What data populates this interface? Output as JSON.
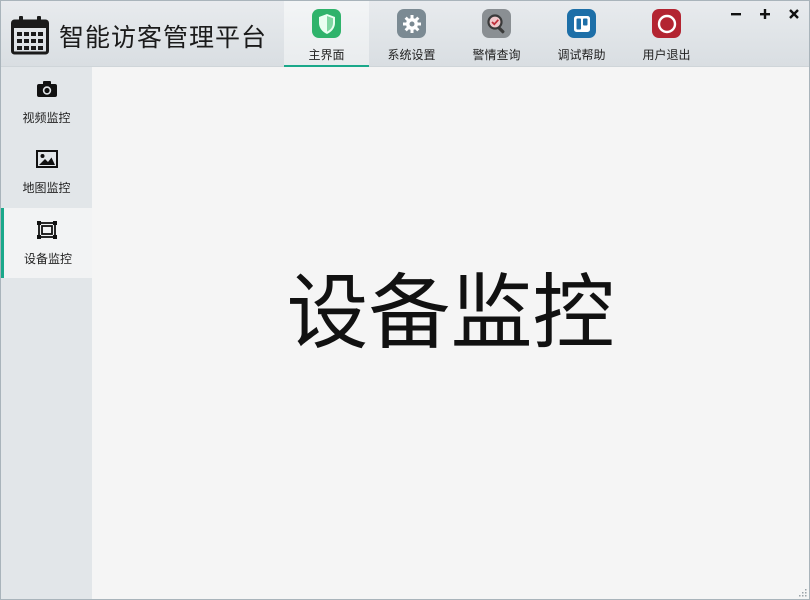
{
  "app": {
    "title": "智能访客管理平台",
    "logo_icon": "calendar-icon"
  },
  "nav": {
    "tabs": [
      {
        "label": "主界面",
        "icon": "shield-icon",
        "color": "#2fb36b",
        "active": true
      },
      {
        "label": "系统设置",
        "icon": "gear-icon",
        "color": "#7b8a93",
        "active": false
      },
      {
        "label": "警情查询",
        "icon": "magnifier-icon",
        "color": "#8a8f93",
        "active": false
      },
      {
        "label": "调试帮助",
        "icon": "board-icon",
        "color": "#1d6fa8",
        "active": false
      },
      {
        "label": "用户退出",
        "icon": "power-icon",
        "color": "#b32431",
        "active": false
      }
    ]
  },
  "window_controls": {
    "minimize": "minimize-icon",
    "maximize": "maximize-icon",
    "close": "close-icon"
  },
  "sidebar": {
    "items": [
      {
        "label": "视频监控",
        "icon": "camera-icon",
        "active": false
      },
      {
        "label": "地图监控",
        "icon": "image-icon",
        "active": false
      },
      {
        "label": "设备监控",
        "icon": "device-frame-icon",
        "active": true
      }
    ]
  },
  "main": {
    "title": "设备监控"
  },
  "colors": {
    "accent": "#1aa88a",
    "titlebar": "#dfe3e6",
    "sidebar": "#e2e6e9",
    "content": "#f5f5f5"
  }
}
